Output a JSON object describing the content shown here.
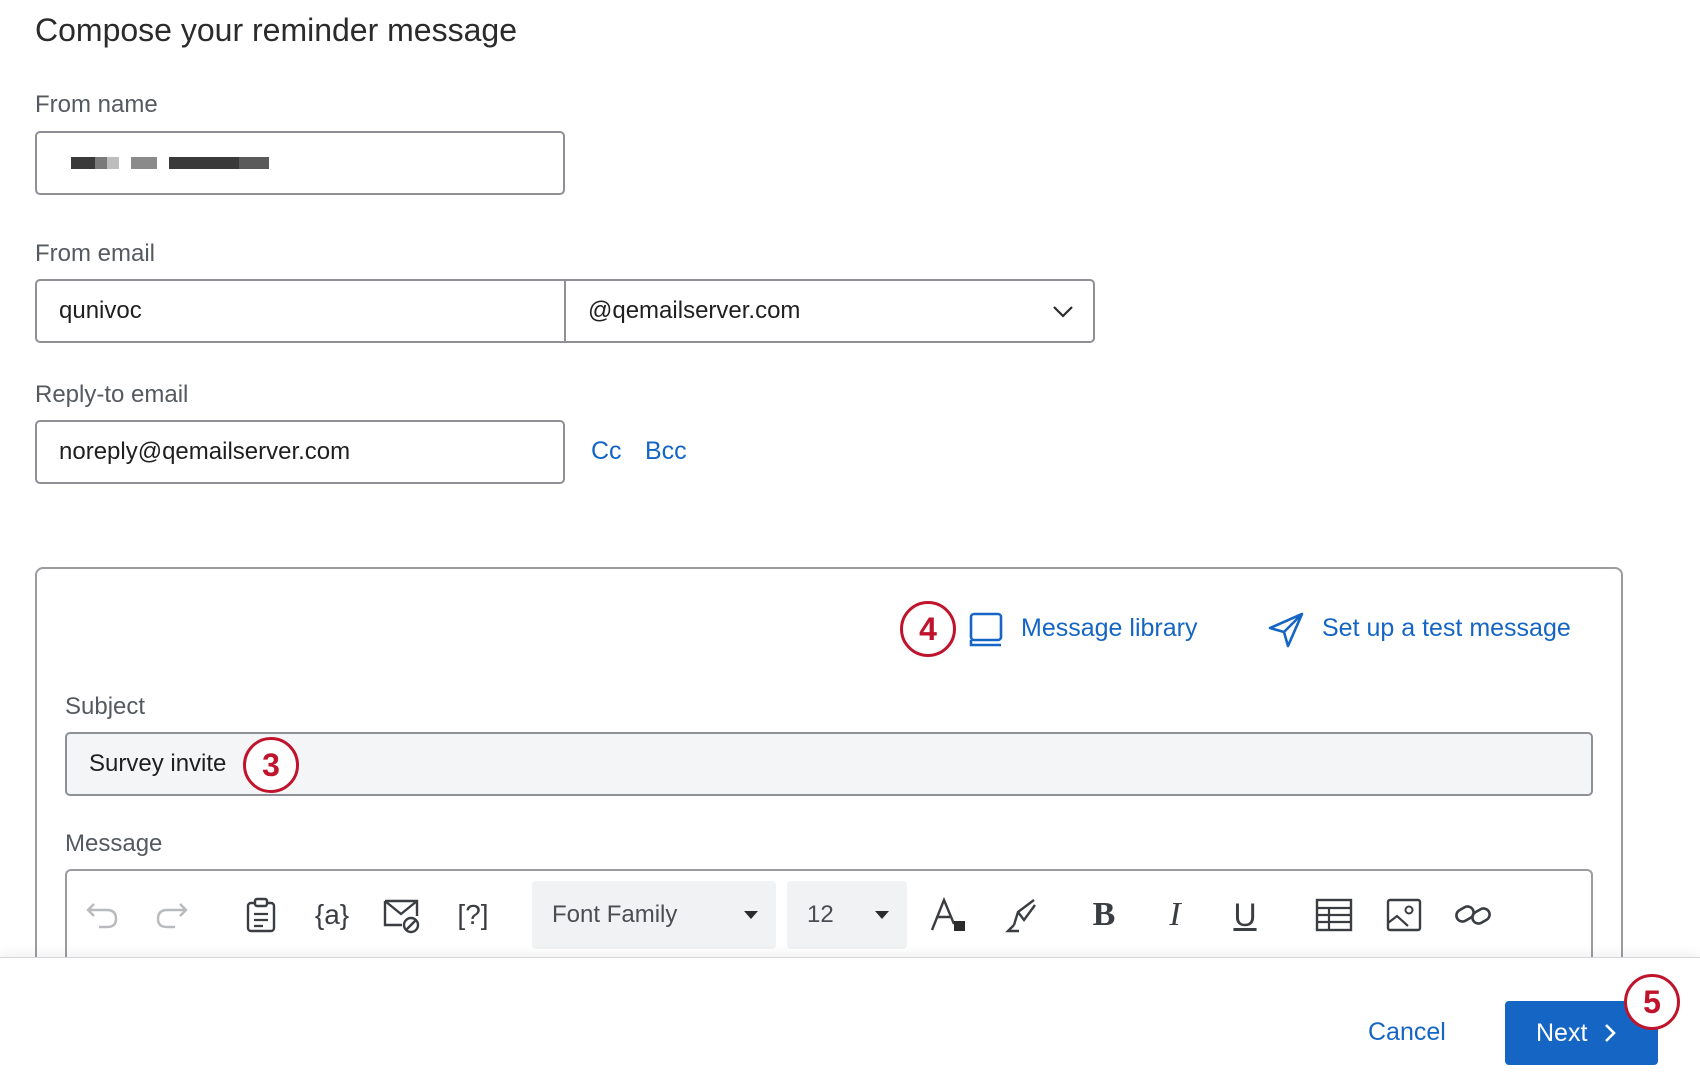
{
  "page": {
    "title": "Compose your reminder message"
  },
  "from_name": {
    "label": "From name",
    "value": ""
  },
  "from_email": {
    "label": "From email",
    "local_part": "qunivoc",
    "domain": "@qemailserver.com"
  },
  "reply_to": {
    "label": "Reply-to email",
    "value": "noreply@qemailserver.com",
    "cc_label": "Cc",
    "bcc_label": "Bcc"
  },
  "actions": {
    "message_library": "Message library",
    "test_message": "Set up a test message"
  },
  "subject": {
    "label": "Subject",
    "value": "Survey invite"
  },
  "message": {
    "label": "Message"
  },
  "toolbar": {
    "font_family": "Font Family",
    "font_size": "12"
  },
  "footer": {
    "cancel_label": "Cancel",
    "next_label": "Next"
  },
  "badges": {
    "b3": "3",
    "b4": "4",
    "b5": "5"
  },
  "colors": {
    "link": "#1566c4",
    "primary": "#1566c4",
    "badge": "#c0142c"
  }
}
